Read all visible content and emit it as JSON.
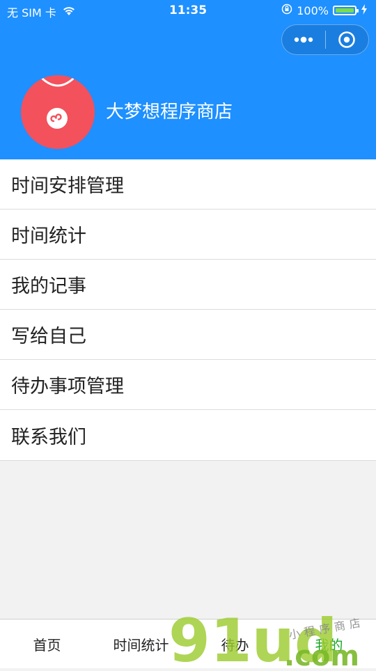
{
  "status_bar": {
    "carrier": "无 SIM 卡",
    "time": "11:35",
    "battery_percent": "100%",
    "battery_level": 1.0,
    "icons": [
      "wifi-icon",
      "orientation-lock-icon",
      "battery-icon",
      "charging-icon"
    ]
  },
  "capsule": {
    "icons": [
      "more-dots-icon",
      "close-target-icon"
    ]
  },
  "profile": {
    "avatar_icon": "mini-program-logo-icon",
    "shop_name": "大梦想程序商店"
  },
  "menu": {
    "items": [
      {
        "label": "时间安排管理"
      },
      {
        "label": "时间统计"
      },
      {
        "label": "我的记事"
      },
      {
        "label": "写给自己"
      },
      {
        "label": "待办事项管理"
      },
      {
        "label": "联系我们"
      }
    ]
  },
  "tabbar": {
    "tabs": [
      {
        "label": "首页"
      },
      {
        "label": "时间统计"
      },
      {
        "label": "待办"
      },
      {
        "label": "我的"
      }
    ],
    "active_index": 3
  },
  "watermark": {
    "text": "91ud",
    "domain": ".com",
    "subtitle": "小程序商店"
  },
  "colors": {
    "header_bg": "#1e90ff",
    "avatar_bg": "#f3515c",
    "active_tab": "#19a524",
    "page_bg": "#f2f2f2"
  }
}
